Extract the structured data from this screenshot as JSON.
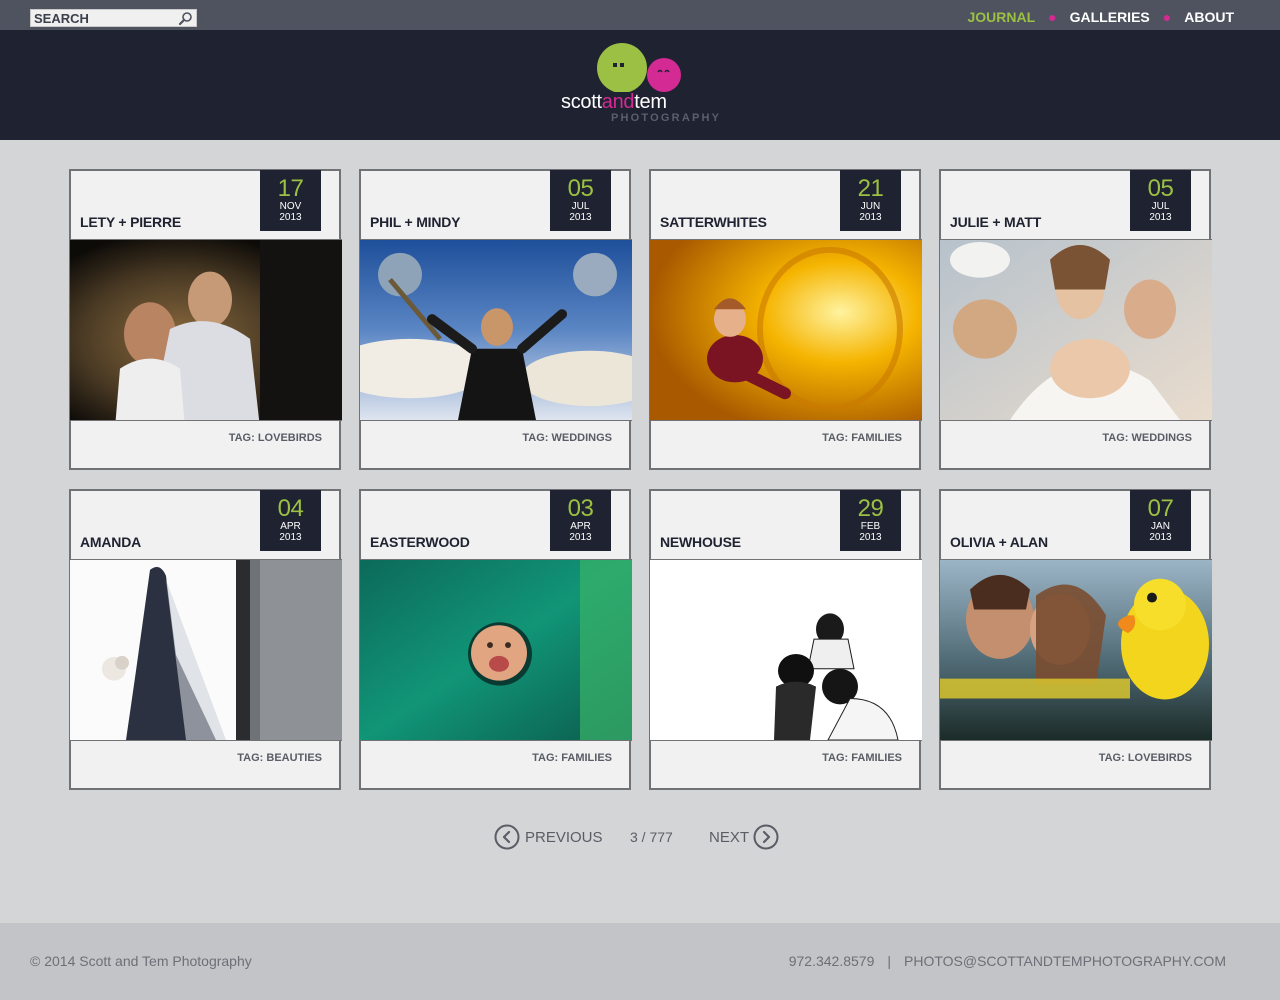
{
  "search": {
    "placeholder": "SEARCH"
  },
  "nav": {
    "items": [
      {
        "label": "JOURNAL",
        "active": true
      },
      {
        "label": "GALLERIES",
        "active": false
      },
      {
        "label": "ABOUT",
        "active": false
      }
    ],
    "separator": "●"
  },
  "logo": {
    "name_part1": "scott",
    "name_part2": "and",
    "name_part3": "tem",
    "subtitle": "PHOTOGRAPHY"
  },
  "posts": [
    {
      "title": "LETY + PIERRE",
      "day": "17",
      "month": "NOV",
      "year": "2013",
      "tag": "TAG: LOVEBIRDS"
    },
    {
      "title": "PHIL + MINDY",
      "day": "05",
      "month": "JUL",
      "year": "2013",
      "tag": "TAG: WEDDINGS"
    },
    {
      "title": "SATTERWHITES",
      "day": "21",
      "month": "JUN",
      "year": "2013",
      "tag": "TAG: FAMILIES"
    },
    {
      "title": "JULIE + MATT",
      "day": "05",
      "month": "JUL",
      "year": "2013",
      "tag": "TAG: WEDDINGS"
    },
    {
      "title": "AMANDA",
      "day": "04",
      "month": "APR",
      "year": "2013",
      "tag": "TAG: BEAUTIES"
    },
    {
      "title": "EASTERWOOD",
      "day": "03",
      "month": "APR",
      "year": "2013",
      "tag": "TAG: FAMILIES"
    },
    {
      "title": "NEWHOUSE",
      "day": "29",
      "month": "FEB",
      "year": "2013",
      "tag": "TAG: FAMILIES"
    },
    {
      "title": "OLIVIA + ALAN",
      "day": "07",
      "month": "JAN",
      "year": "2013",
      "tag": "TAG: LOVEBIRDS"
    }
  ],
  "pager": {
    "previous": "PREVIOUS",
    "next": "NEXT",
    "count": "3 / 777"
  },
  "footer": {
    "copyright": "© 2014 Scott and Tem Photography",
    "phone": "972.342.8579",
    "separator": "|",
    "email": "PHOTOS@SCOTTANDTEMPHOTOGRAPHY.COM"
  },
  "colors": {
    "accent_green": "#9bc043",
    "accent_pink": "#d32a94",
    "dark_navy": "#1f2230",
    "topbar": "#4e535f"
  }
}
